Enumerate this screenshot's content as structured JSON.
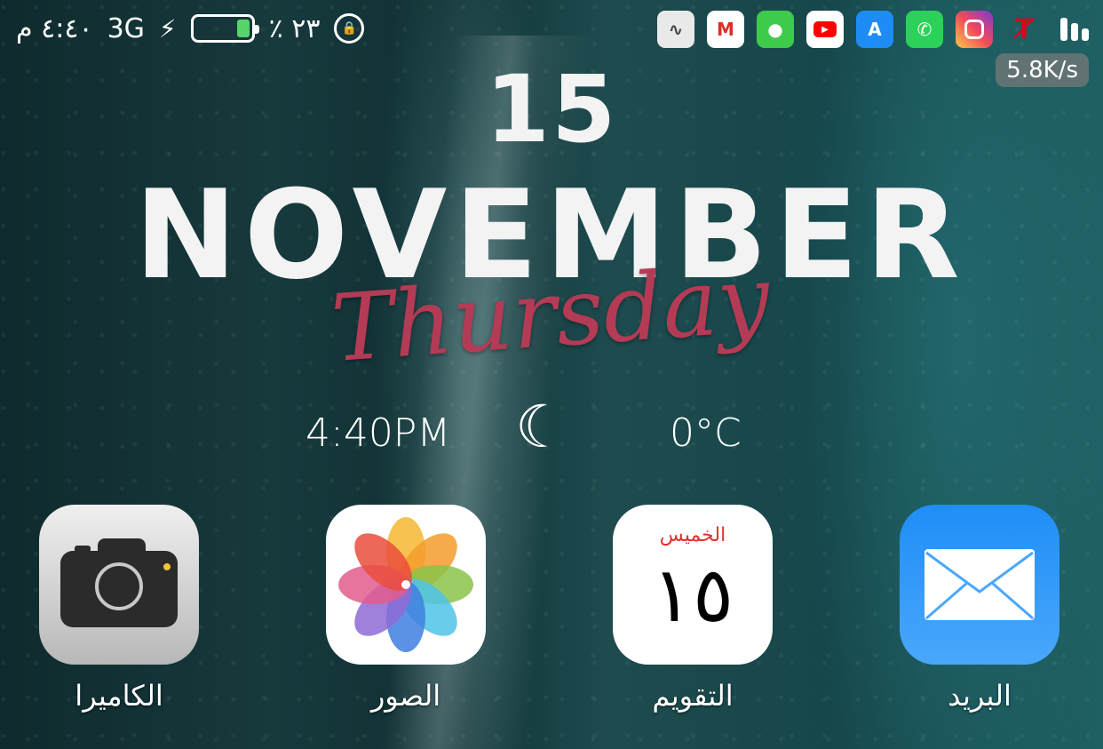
{
  "status_bar": {
    "time": "٤:٤٠ م",
    "network": "3G",
    "battery_percent": "٪ ٢٣",
    "battery_level": 0.23,
    "battery_color": "#59d36b",
    "charging_icon": "bolt-icon",
    "orientation_lock_icon": "orientation-lock-icon",
    "notification_icons": [
      "soundwave-app-icon",
      "gmail-icon",
      "messages-icon",
      "youtube-icon",
      "app-store-icon",
      "whatsapp-icon",
      "instagram-icon",
      "avira-icon"
    ],
    "net_speed": "5.8K/s"
  },
  "widget": {
    "day_number": "15",
    "month": "NOVEMBER",
    "weekday": "Thursday",
    "weekday_color": "#b33b55",
    "time": "4:40PM",
    "weather_icon": "crescent-moon-icon",
    "temperature": "0°C"
  },
  "apps": [
    {
      "label": "الكاميرا",
      "icon": "camera-icon"
    },
    {
      "label": "الصور",
      "icon": "photos-icon"
    },
    {
      "label": "التقويم",
      "icon": "calendar-icon",
      "calendar_weekday": "الخميس",
      "calendar_day": "١٥"
    },
    {
      "label": "البريد",
      "icon": "mail-icon"
    }
  ]
}
